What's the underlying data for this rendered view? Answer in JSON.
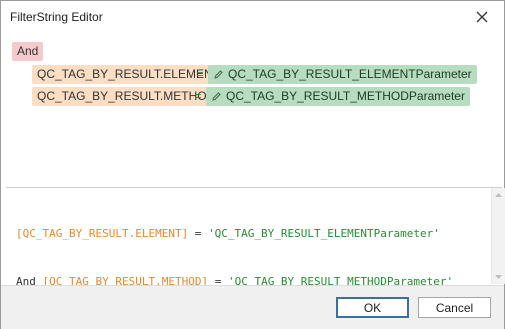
{
  "window": {
    "title": "FilterString Editor",
    "close_icon": "close-icon"
  },
  "builder": {
    "group_operator": "And",
    "conditions": [
      {
        "field": "QC_TAG_BY_RESULT.ELEMENT",
        "operator": "=",
        "value": "QC_TAG_BY_RESULT_ELEMENTParameter"
      },
      {
        "field": "QC_TAG_BY_RESULT.METHOD",
        "operator": "=",
        "value": "QC_TAG_BY_RESULT_METHODParameter"
      }
    ],
    "value_icon": "pencil-icon",
    "colors": {
      "group": "#f6c9cc",
      "field": "#fbdec4",
      "value": "#b7dcc0",
      "operator": "#2f8a3c"
    }
  },
  "text": {
    "lines": [
      {
        "prefix": "",
        "field": "[QC_TAG_BY_RESULT.ELEMENT]",
        "op": " = ",
        "value": "'QC_TAG_BY_RESULT_ELEMENTParameter'"
      },
      {
        "prefix": "And ",
        "field": "[QC_TAG_BY_RESULT.METHOD]",
        "op": " = ",
        "value": "'QC_TAG_BY_RESULT_METHODParameter'"
      }
    ],
    "colors": {
      "field": "#e08a35",
      "string": "#2a8a33"
    }
  },
  "footer": {
    "ok_label": "OK",
    "cancel_label": "Cancel"
  }
}
